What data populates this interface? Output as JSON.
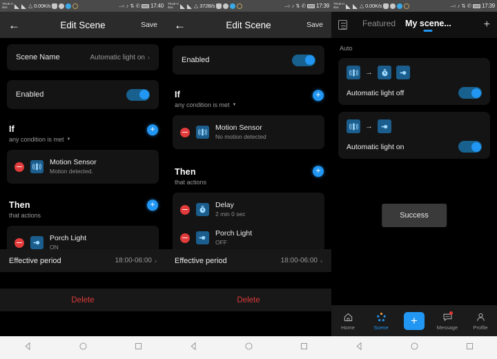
{
  "panel1": {
    "status": {
      "carrier": "TRUE-H dtac",
      "netspeed": "0.00K/s",
      "clock": "17:40"
    },
    "appbar": {
      "back_icon": "arrow-left-icon",
      "title": "Edit Scene",
      "save_label": "Save"
    },
    "scene_name": {
      "label": "Scene Name",
      "value": "Automatic light on",
      "chevron": "›"
    },
    "enabled": {
      "label": "Enabled",
      "state": "on"
    },
    "if_section": {
      "heading": "If",
      "subtitle": "any condition is met",
      "add_label": "+"
    },
    "conditions": [
      {
        "name": "Motion Sensor",
        "state": "Motion detected.",
        "icon": "motion-sensor-icon"
      }
    ],
    "then_section": {
      "heading": "Then",
      "subtitle": "that actions",
      "add_label": "+"
    },
    "actions": [
      {
        "name": "Porch Light",
        "state": "ON",
        "icon": "light-bulb-icon"
      }
    ],
    "effective_period": {
      "label": "Effective period",
      "value": "18:00-06:00",
      "chevron": "›"
    },
    "delete_label": "Delete"
  },
  "panel2": {
    "status": {
      "carrier": "TRUE-H dtac",
      "netspeed": "372B/s",
      "clock": "17:39"
    },
    "appbar": {
      "back_icon": "arrow-left-icon",
      "title": "Edit Scene",
      "save_label": "Save"
    },
    "enabled": {
      "label": "Enabled",
      "state": "on"
    },
    "if_section": {
      "heading": "If",
      "subtitle": "any condition is met",
      "add_label": "+"
    },
    "conditions": [
      {
        "name": "Motion Sensor",
        "state": "No motion detected",
        "icon": "motion-sensor-icon"
      }
    ],
    "then_section": {
      "heading": "Then",
      "subtitle": "that actions",
      "add_label": "+"
    },
    "actions": [
      {
        "name": "Delay",
        "state": "2 min 0 sec",
        "icon": "timer-icon"
      },
      {
        "name": "Porch Light",
        "state": "OFF",
        "icon": "light-bulb-icon"
      }
    ],
    "effective_period": {
      "label": "Effective period",
      "value": "18:00-06:00",
      "chevron": "›"
    },
    "delete_label": "Delete"
  },
  "panel3": {
    "status": {
      "carrier": "TRUE-H dtac",
      "netspeed": "0.00K/s",
      "clock": "17:39"
    },
    "tabbar": {
      "list_icon": "list-icon",
      "tab_featured": "Featured",
      "tab_my_scene": "My scene...",
      "add_label": "+"
    },
    "group_label": "Auto",
    "scenes": [
      {
        "name": "Automatic light off",
        "icons": [
          "motion-sensor-icon",
          "timer-icon",
          "light-bulb-icon"
        ],
        "arrow": "→",
        "state": "on"
      },
      {
        "name": "Automatic light on",
        "icons": [
          "motion-sensor-icon",
          "light-bulb-icon"
        ],
        "arrow": "→",
        "state": "on"
      }
    ],
    "toast": "Success",
    "bottomnav": [
      {
        "label": "Home",
        "icon": "home-icon",
        "active": false
      },
      {
        "label": "Scene",
        "icon": "scene-icon",
        "active": true
      },
      {
        "label": "",
        "icon": "plus-icon",
        "active": false
      },
      {
        "label": "Message",
        "icon": "message-icon",
        "active": false
      },
      {
        "label": "Profile",
        "icon": "profile-icon",
        "active": false
      }
    ]
  },
  "colors": {
    "accent": "#2196f3",
    "delete": "#e03a3a",
    "card": "#141414",
    "appbar": "#2b2b2b"
  }
}
